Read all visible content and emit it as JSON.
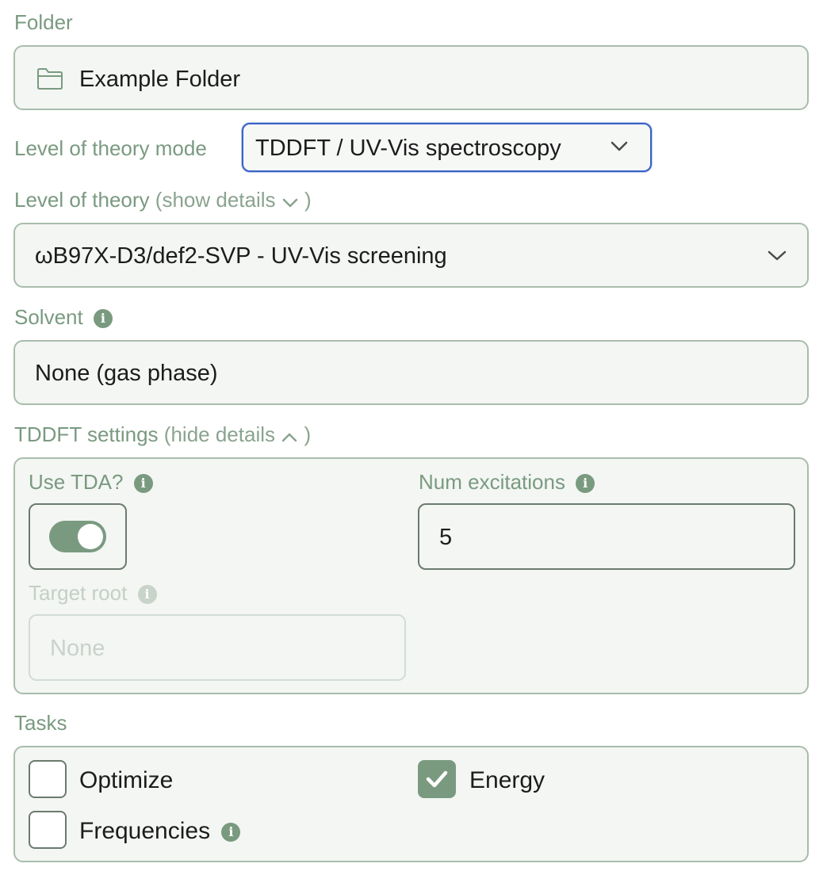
{
  "folder": {
    "label": "Folder",
    "value": "Example Folder",
    "icon": "folder-icon"
  },
  "level_of_theory_mode": {
    "label": "Level of theory mode",
    "value": "TDDFT / UV-Vis spectroscopy"
  },
  "level_of_theory": {
    "label": "Level of theory",
    "toggle_open": "(show details",
    "toggle_close": ")",
    "value": "ωB97X-D3/def2-SVP - UV-Vis screening"
  },
  "solvent": {
    "label": "Solvent",
    "value": "None (gas phase)"
  },
  "tddft_settings": {
    "label": "TDDFT settings",
    "toggle_open": "(hide details",
    "toggle_close": ")",
    "use_tda": {
      "label": "Use TDA?",
      "enabled": true
    },
    "num_excitations": {
      "label": "Num excitations",
      "value": "5"
    },
    "target_root": {
      "label": "Target root",
      "placeholder": "None"
    }
  },
  "tasks": {
    "label": "Tasks",
    "items": [
      {
        "label": "Optimize",
        "checked": false
      },
      {
        "label": "Energy",
        "checked": true
      },
      {
        "label": "Frequencies",
        "checked": false
      }
    ]
  },
  "colors": {
    "accent": "#7a9a80",
    "field_bg": "#f3f6f3",
    "border": "#a9bcac",
    "focus_border": "#3b62c4"
  }
}
